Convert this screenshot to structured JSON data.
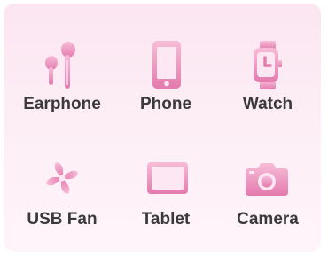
{
  "devices": [
    {
      "label": "Earphone",
      "icon": "earphone-icon"
    },
    {
      "label": "Phone",
      "icon": "phone-icon"
    },
    {
      "label": "Watch",
      "icon": "watch-icon"
    },
    {
      "label": "USB Fan",
      "icon": "usb-fan-icon"
    },
    {
      "label": "Tablet",
      "icon": "tablet-icon"
    },
    {
      "label": "Camera",
      "icon": "camera-icon"
    }
  ],
  "colors": {
    "icon_light": "#f5b3d1",
    "icon_dark": "#e47aad",
    "label_text": "#3a3a3a",
    "panel_top": "#fbe6f1",
    "panel_bottom": "#fef5fa"
  }
}
